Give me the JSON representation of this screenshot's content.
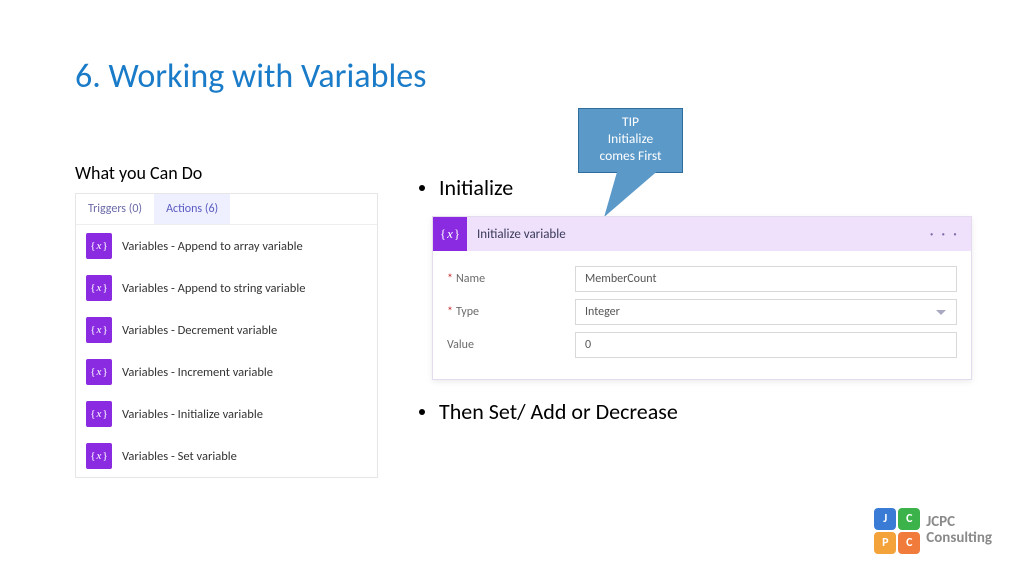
{
  "title": "6. Working with Variables",
  "subtitle": "What you Can Do",
  "tabs": {
    "triggers": "Triggers (0)",
    "actions": "Actions (6)"
  },
  "actions": [
    "Variables - Append to array variable",
    "Variables - Append to string variable",
    "Variables - Decrement variable",
    "Variables - Increment variable",
    "Variables - Initialize variable",
    "Variables - Set variable"
  ],
  "bullets": {
    "b1": "Initialize",
    "b2": "Then Set/ Add or Decrease"
  },
  "tip": {
    "line1": "TIP",
    "line2": "Initialize",
    "line3": "comes First"
  },
  "card": {
    "header": "Initialize variable",
    "fields": {
      "name_label": "Name",
      "name_value": "MemberCount",
      "type_label": "Type",
      "type_value": "Integer",
      "value_label": "Value",
      "value_value": "0"
    },
    "ellipsis": "· · ·"
  },
  "icon_glyph": "x",
  "logo": {
    "j": "J",
    "c": "C",
    "p": "P",
    "c2": "C",
    "l1": "JCPC",
    "l2": "Consulting"
  }
}
